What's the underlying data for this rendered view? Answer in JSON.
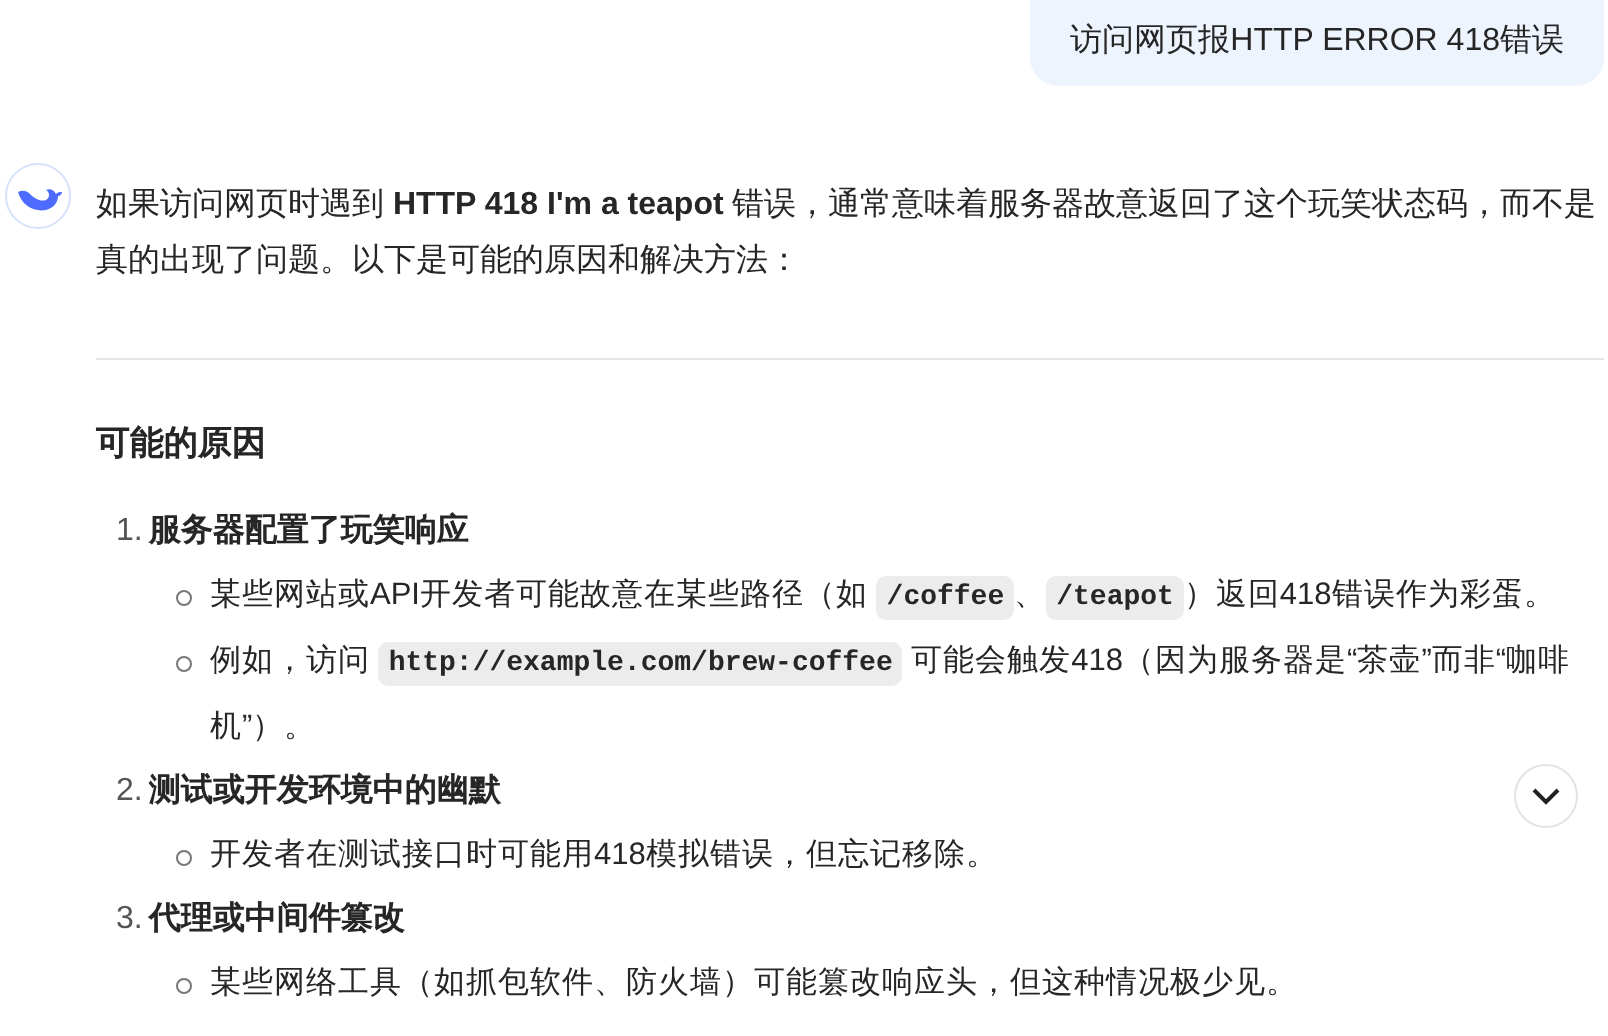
{
  "user_message": "访问网页报HTTP ERROR 418错误",
  "answer": {
    "intro": "如果访问网页时遇到 **HTTP 418 I'm a teapot** 错误，通常意味着服务器故意返回了这个玩笑状态码，而不是真的出现了问题。以下是可能的原因和解决方法：",
    "heading": "可能的原因",
    "items": [
      {
        "number": "1.",
        "title": "服务器配置了玩笑响应",
        "bullets": [
          [
            {
              "kind": "text",
              "text": "某些网站或API开发者可能故意在某些路径（如 "
            },
            {
              "kind": "code",
              "text": "/coffee"
            },
            {
              "kind": "text",
              "text": "、"
            },
            {
              "kind": "code",
              "text": "/teapot"
            },
            {
              "kind": "text",
              "text": "）返回418错误作为彩蛋。"
            }
          ],
          [
            {
              "kind": "text",
              "text": "例如，访问 "
            },
            {
              "kind": "code",
              "text": "http://example.com/brew-coffee"
            },
            {
              "kind": "text",
              "text": " 可能会触发418（因为服务器是“茶壶”而非“咖啡机”）。"
            }
          ]
        ]
      },
      {
        "number": "2.",
        "title": "测试或开发环境中的幽默",
        "bullets": [
          [
            {
              "kind": "text",
              "text": "开发者在测试接口时可能用418模拟错误，但忘记移除。"
            }
          ]
        ]
      },
      {
        "number": "3.",
        "title": "代理或中间件篡改",
        "bullets": [
          [
            {
              "kind": "text",
              "text": "某些网络工具（如抓包软件、防火墙）可能篡改响应头，但这种情况极少见。"
            }
          ]
        ]
      }
    ]
  }
}
